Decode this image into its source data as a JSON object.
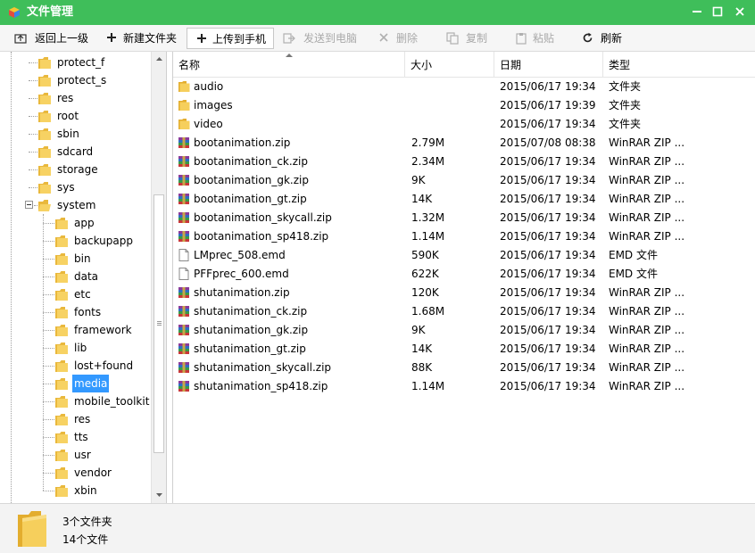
{
  "window": {
    "title": "文件管理",
    "accent_color": "#3fbe5a"
  },
  "toolbar": {
    "back_label": "返回上一级",
    "new_folder_label": "新建文件夹",
    "upload_label": "上传到手机",
    "send_to_pc_label": "发送到电脑",
    "delete_label": "删除",
    "copy_label": "复制",
    "paste_label": "粘贴",
    "refresh_label": "刷新"
  },
  "tree": {
    "items": [
      {
        "label": "protect_f"
      },
      {
        "label": "protect_s"
      },
      {
        "label": "res"
      },
      {
        "label": "root"
      },
      {
        "label": "sbin"
      },
      {
        "label": "sdcard"
      },
      {
        "label": "storage"
      },
      {
        "label": "sys"
      },
      {
        "label": "system"
      },
      {
        "label": "app"
      },
      {
        "label": "backupapp"
      },
      {
        "label": "bin"
      },
      {
        "label": "data"
      },
      {
        "label": "etc"
      },
      {
        "label": "fonts"
      },
      {
        "label": "framework"
      },
      {
        "label": "lib"
      },
      {
        "label": "lost+found"
      },
      {
        "label": "media"
      },
      {
        "label": "mobile_toolkit"
      },
      {
        "label": "res"
      },
      {
        "label": "tts"
      },
      {
        "label": "usr"
      },
      {
        "label": "vendor"
      },
      {
        "label": "xbin"
      }
    ]
  },
  "list": {
    "columns": [
      "名称",
      "大小",
      "日期",
      "类型"
    ],
    "rows": [
      {
        "name": "audio",
        "size": "",
        "date": "2015/06/17 19:34",
        "type": "文件夹",
        "icon": "folder-icon"
      },
      {
        "name": "images",
        "size": "",
        "date": "2015/06/17 19:39",
        "type": "文件夹",
        "icon": "folder-icon"
      },
      {
        "name": "video",
        "size": "",
        "date": "2015/06/17 19:34",
        "type": "文件夹",
        "icon": "folder-icon"
      },
      {
        "name": "bootanimation.zip",
        "size": "2.79M",
        "date": "2015/07/08 08:38",
        "type": "WinRAR ZIP ...",
        "icon": "winrar-archive-icon"
      },
      {
        "name": "bootanimation_ck.zip",
        "size": "2.34M",
        "date": "2015/06/17 19:34",
        "type": "WinRAR ZIP ...",
        "icon": "winrar-archive-icon"
      },
      {
        "name": "bootanimation_gk.zip",
        "size": "9K",
        "date": "2015/06/17 19:34",
        "type": "WinRAR ZIP ...",
        "icon": "winrar-archive-icon"
      },
      {
        "name": "bootanimation_gt.zip",
        "size": "14K",
        "date": "2015/06/17 19:34",
        "type": "WinRAR ZIP ...",
        "icon": "winrar-archive-icon"
      },
      {
        "name": "bootanimation_skycall.zip",
        "size": "1.32M",
        "date": "2015/06/17 19:34",
        "type": "WinRAR ZIP ...",
        "icon": "winrar-archive-icon"
      },
      {
        "name": "bootanimation_sp418.zip",
        "size": "1.14M",
        "date": "2015/06/17 19:34",
        "type": "WinRAR ZIP ...",
        "icon": "winrar-archive-icon"
      },
      {
        "name": "LMprec_508.emd",
        "size": "590K",
        "date": "2015/06/17 19:34",
        "type": "EMD 文件",
        "icon": "file-icon"
      },
      {
        "name": "PFFprec_600.emd",
        "size": "622K",
        "date": "2015/06/17 19:34",
        "type": "EMD 文件",
        "icon": "file-icon"
      },
      {
        "name": "shutanimation.zip",
        "size": "120K",
        "date": "2015/06/17 19:34",
        "type": "WinRAR ZIP ...",
        "icon": "winrar-archive-icon"
      },
      {
        "name": "shutanimation_ck.zip",
        "size": "1.68M",
        "date": "2015/06/17 19:34",
        "type": "WinRAR ZIP ...",
        "icon": "winrar-archive-icon"
      },
      {
        "name": "shutanimation_gk.zip",
        "size": "9K",
        "date": "2015/06/17 19:34",
        "type": "WinRAR ZIP ...",
        "icon": "winrar-archive-icon"
      },
      {
        "name": "shutanimation_gt.zip",
        "size": "14K",
        "date": "2015/06/17 19:34",
        "type": "WinRAR ZIP ...",
        "icon": "winrar-archive-icon"
      },
      {
        "name": "shutanimation_skycall.zip",
        "size": "88K",
        "date": "2015/06/17 19:34",
        "type": "WinRAR ZIP ...",
        "icon": "winrar-archive-icon"
      },
      {
        "name": "shutanimation_sp418.zip",
        "size": "1.14M",
        "date": "2015/06/17 19:34",
        "type": "WinRAR ZIP ...",
        "icon": "winrar-archive-icon"
      }
    ]
  },
  "status": {
    "folder_count": "3个文件夹",
    "file_count": "14个文件"
  }
}
